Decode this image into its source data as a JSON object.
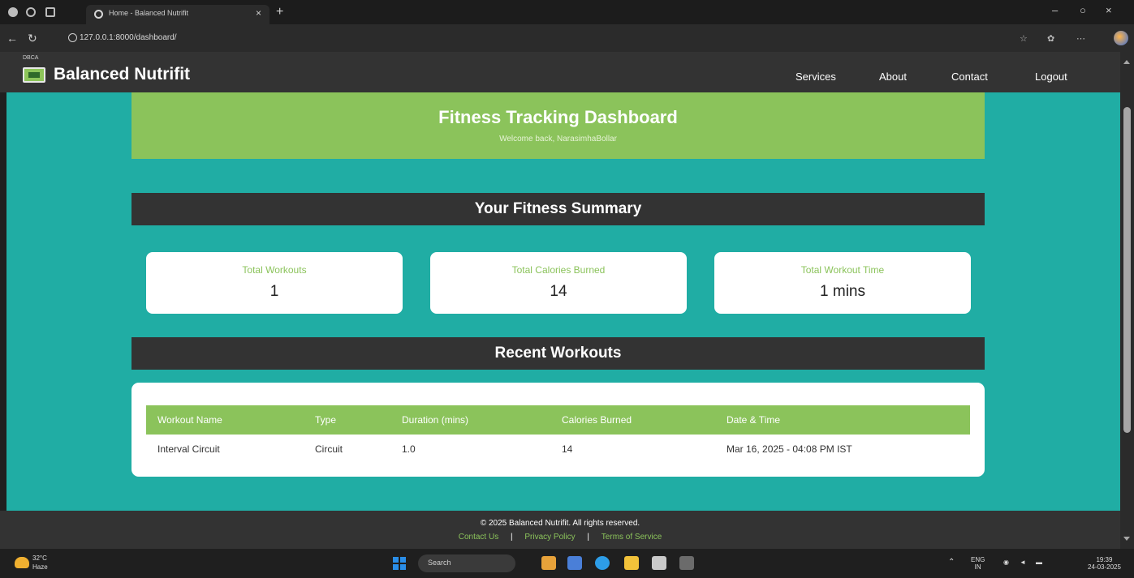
{
  "browser": {
    "tab_title": "Home - Balanced Nutrifit",
    "url": "127.0.0.1:8000/dashboard/",
    "new_tab_symbol": "+",
    "close_tab_symbol": "×",
    "window_controls": [
      "–",
      "○",
      "×"
    ],
    "toolbar_icons": [
      "star-icon",
      "extensions-icon",
      "more-icon"
    ]
  },
  "navbar": {
    "tiny_text": "DBCA",
    "brand": "Balanced Nutrifit",
    "links": [
      "Services",
      "About",
      "Contact",
      "Logout"
    ]
  },
  "hero": {
    "title": "Fitness Tracking Dashboard",
    "subtitle": "Welcome back, NarasimhaBollar"
  },
  "summary": {
    "heading": "Your Fitness Summary",
    "cards": [
      {
        "label": "Total Workouts",
        "value": "1"
      },
      {
        "label": "Total Calories Burned",
        "value": "14"
      },
      {
        "label": "Total Workout Time",
        "value": "1 mins"
      }
    ]
  },
  "recent": {
    "heading": "Recent Workouts",
    "columns": [
      "Workout Name",
      "Type",
      "Duration (mins)",
      "Calories Burned",
      "Date & Time"
    ],
    "rows": [
      [
        "Interval Circuit",
        "Circuit",
        "1.0",
        "14",
        "Mar 16, 2025 - 04:08 PM IST"
      ]
    ]
  },
  "footer": {
    "copyright": "© 2025 Balanced Nutrifit. All rights reserved.",
    "links": [
      "Contact Us",
      "Privacy Policy",
      "Terms of Service"
    ],
    "separator": "|"
  },
  "taskbar": {
    "weather_temp": "32°C",
    "weather_desc": "Haze",
    "search_placeholder": "Search",
    "lang": "ENG",
    "region": "IN",
    "time": "19:39",
    "date": "24-03-2025"
  },
  "colors": {
    "accent_green": "#8bc35b",
    "teal_background": "#20ada4",
    "dark_bar": "#333333"
  }
}
